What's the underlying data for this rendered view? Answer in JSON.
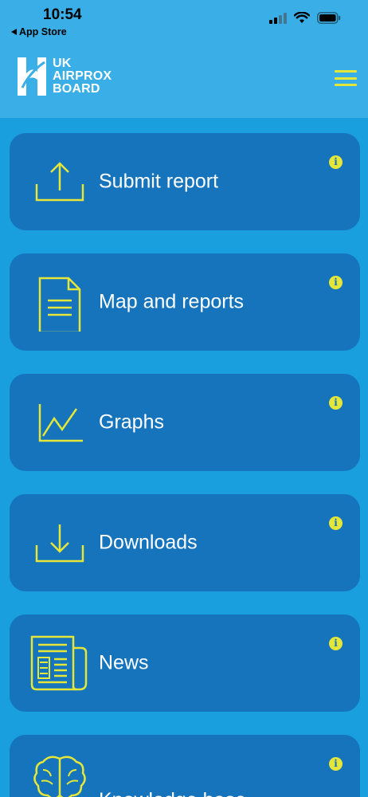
{
  "status_bar": {
    "time": "10:54",
    "back_label": "App Store"
  },
  "header": {
    "logo_lines": [
      "UK",
      "AIRPROX",
      "BOARD"
    ]
  },
  "menu": {
    "items": [
      {
        "label": "Submit report",
        "icon": "upload-icon"
      },
      {
        "label": "Map and reports",
        "icon": "document-icon"
      },
      {
        "label": "Graphs",
        "icon": "line-chart-icon"
      },
      {
        "label": "Downloads",
        "icon": "download-icon"
      },
      {
        "label": "News",
        "icon": "newspaper-icon"
      },
      {
        "label": "Knowledge base",
        "icon": "brain-icon"
      }
    ],
    "info_glyph": "i"
  },
  "colors": {
    "background": "#1a9fde",
    "header": "#3aaee6",
    "card": "#1574bc",
    "accent": "#e5e63a"
  }
}
